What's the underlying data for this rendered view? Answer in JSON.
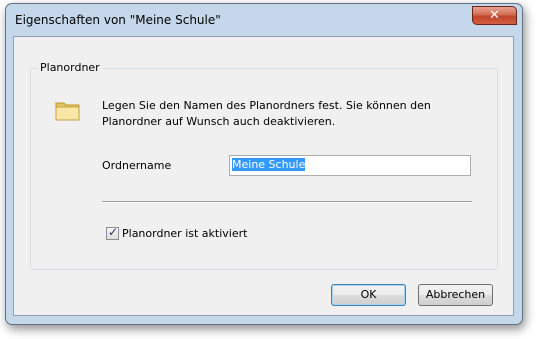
{
  "window": {
    "title": "Eigenschaften von \"Meine Schule\"",
    "close_glyph": "✕"
  },
  "group": {
    "label": "Planordner",
    "description": "Legen Sie den Namen des Planordners fest. Sie können den Planordner auf Wunsch auch deaktivieren."
  },
  "name_field": {
    "label": "Ordnername",
    "value": "Meine Schule"
  },
  "checkbox": {
    "label": "Planordner ist aktiviert",
    "checked": true,
    "glyph": "✓"
  },
  "buttons": {
    "ok": "OK",
    "cancel": "Abbrechen"
  },
  "icons": {
    "folder": "folder-icon",
    "close": "close-icon"
  }
}
